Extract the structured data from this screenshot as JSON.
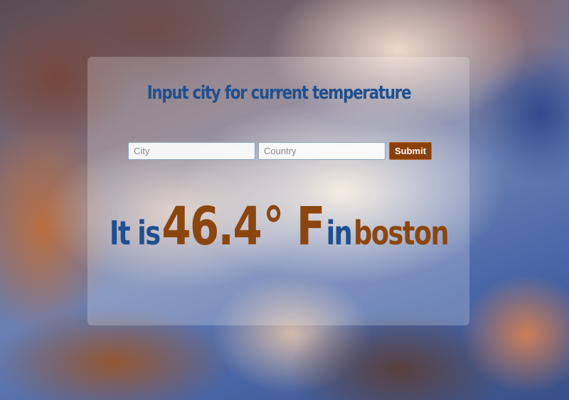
{
  "title": "Input city for current temperature",
  "form": {
    "city_placeholder": "City",
    "country_placeholder": "Country",
    "submit_label": "Submit"
  },
  "result": {
    "prefix": "It is",
    "temperature": "46.4",
    "unit": "° F",
    "connector": "in",
    "city": "boston"
  },
  "colors": {
    "heading_blue": "#1f4f8f",
    "accent_orange": "#8b460f",
    "button_bg": "#8b3f0a"
  }
}
